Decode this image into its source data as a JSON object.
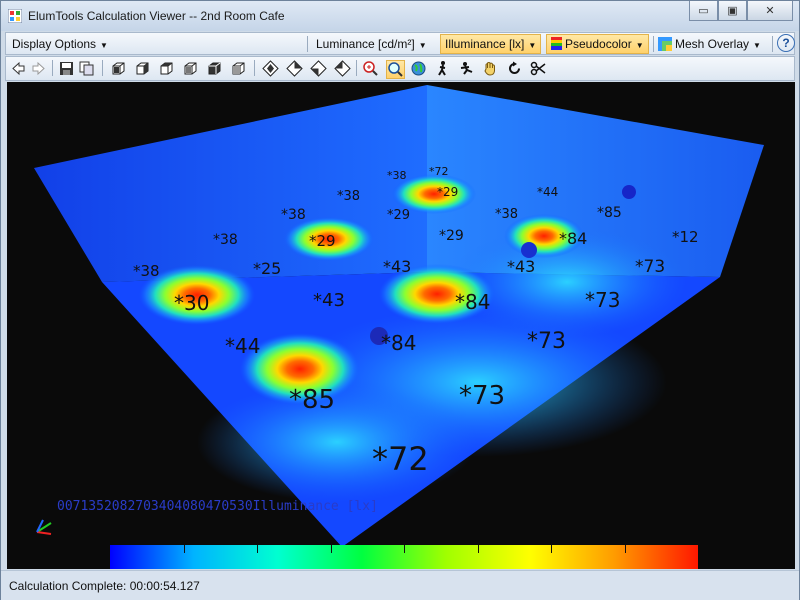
{
  "window": {
    "title": "ElumTools Calculation Viewer -- 2nd Room Cafe",
    "minimize_glyph": "▭",
    "maximize_glyph": "▣",
    "close_glyph": "✕"
  },
  "menu": {
    "display_options": "Display Options",
    "luminance": "Luminance [cd/m²]",
    "illuminance": "Illuminance [lx]",
    "pseudocolor": "Pseudocolor",
    "mesh_overlay": "Mesh Overlay",
    "help": "?"
  },
  "toolbar2_icons": [
    "back-arrow-icon",
    "forward-arrow-icon",
    "save-icon",
    "copy-icon",
    "view-front-icon",
    "view-back-icon",
    "view-left-icon",
    "view-right-icon",
    "view-top-icon",
    "view-iso-icon",
    "orbit-1-icon",
    "orbit-2-icon",
    "orbit-3-icon",
    "orbit-4-icon",
    "zoom-extents-icon",
    "zoom-window-icon",
    "globe-icon",
    "walk-icon",
    "fly-icon",
    "hand-icon",
    "refresh-icon",
    "scissors-icon"
  ],
  "viewport": {
    "legend_overlay": "0071352082703404080470530Illuminance [lx]",
    "floor_labels": [
      "*38",
      "*25",
      "*30",
      "*44",
      "*85",
      "*38",
      "*29",
      "*43",
      "*84",
      "*72",
      "*38",
      "*38",
      "*29",
      "*43",
      "*84",
      "*73",
      "*38",
      "*29",
      "*43",
      "*84",
      "*73",
      "*73",
      "*44",
      "*85",
      "*12",
      "*73",
      "*72"
    ],
    "wall_labels": [
      "*38",
      "*29"
    ],
    "colors": {
      "floor": "#1040ff",
      "wall": "#1f6bff",
      "hot": "#ff3000",
      "background": "#0a0a0a"
    }
  },
  "color_scale": {
    "stops": [
      "#0000ff",
      "#00b4ff",
      "#00ffd0",
      "#00ff40",
      "#a0ff00",
      "#ffff00",
      "#ff9c00",
      "#ff1800"
    ],
    "ticks": 8
  },
  "status": {
    "label": "Calculation Complete:  00:00:54.127"
  }
}
